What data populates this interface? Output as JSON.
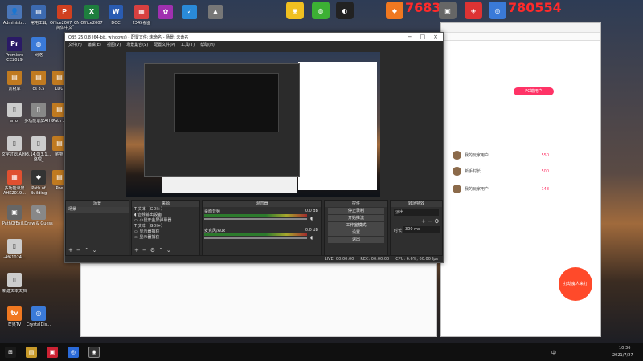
{
  "overlay": {
    "left_num": "76836",
    "right_num": "780554"
  },
  "top_icons": [
    {
      "name": "app-yellow-icon",
      "color": "#f0c020",
      "glyph": "◉"
    },
    {
      "name": "wechat-icon",
      "color": "#3cb034",
      "glyph": "◍"
    },
    {
      "name": "qq-icon",
      "color": "#222",
      "glyph": "◐"
    },
    {
      "name": "app-orange-icon",
      "color": "#f07820",
      "glyph": "◆"
    },
    {
      "name": "app-gray-icon",
      "color": "#666",
      "glyph": "▣"
    },
    {
      "name": "app-red-icon",
      "color": "#d33",
      "glyph": "◈"
    },
    {
      "name": "app-blue-icon",
      "color": "#3a7ad8",
      "glyph": "◎"
    }
  ],
  "desktop_icons": [
    {
      "label": "Administr...",
      "color": "#4a76b8",
      "glyph": "👤"
    },
    {
      "label": "常用工具",
      "color": "#3c6ab0",
      "glyph": "▤"
    },
    {
      "label": "Office2007_CN 简体中文",
      "color": "#d04020",
      "glyph": "P"
    },
    {
      "label": "Office2007",
      "color": "#1e7e3e",
      "glyph": "X"
    },
    {
      "label": "DOC",
      "color": "#2a5cb2",
      "glyph": "W"
    },
    {
      "label": "2345看图",
      "color": "#d84040",
      "glyph": "▦"
    },
    {
      "label": "",
      "color": "#a030b0",
      "glyph": "✿"
    },
    {
      "label": "",
      "color": "#2a8ad8",
      "glyph": "✓"
    },
    {
      "label": "",
      "color": "#777",
      "glyph": "▲"
    },
    {
      "label": "Premiere CC2019",
      "color": "#2a1a66",
      "glyph": "Pr"
    },
    {
      "label": "网络",
      "color": "#3a7ad8",
      "glyph": "◍"
    },
    {
      "label": "素材库",
      "color": "#c07a20",
      "glyph": "▤"
    },
    {
      "label": "cs 8.5",
      "color": "#c07a20",
      "glyph": "▤"
    },
    {
      "label": "LOG",
      "color": "#c07a20",
      "glyph": "▤"
    },
    {
      "label": "error",
      "color": "#ccc",
      "glyph": "▯"
    },
    {
      "label": "多功能录屏AHK",
      "color": "#888",
      "glyph": "▯"
    },
    {
      "label": "Path of",
      "color": "#c07a20",
      "glyph": "▤"
    },
    {
      "label": "文字过滤 AHK",
      "color": "#ccc",
      "glyph": "▯"
    },
    {
      "label": "3.14.0(3.1... 整理_",
      "color": "#ccc",
      "glyph": "▯"
    },
    {
      "label": "购物",
      "color": "#c07a20",
      "glyph": "▤"
    },
    {
      "label": "多功能录屏AHK2019...",
      "color": "#e05030",
      "glyph": "▦"
    },
    {
      "label": "Path of Building",
      "color": "#333",
      "glyph": "◆"
    },
    {
      "label": "Poe",
      "color": "#c07a20",
      "glyph": "▤"
    },
    {
      "label": "PathOfExil...",
      "color": "#666",
      "glyph": "▣"
    },
    {
      "label": "Draw & Guess",
      "color": "#888",
      "glyph": "✎"
    },
    {
      "label": "-4f61024...",
      "color": "#ccc",
      "glyph": "▯"
    },
    {
      "label": "新建文本文档",
      "color": "#ccc",
      "glyph": "▯"
    },
    {
      "label": "芒果TV",
      "color": "#f07820",
      "glyph": "tv"
    },
    {
      "label": "CrystalDis...",
      "color": "#3a7ad8",
      "glyph": "◎"
    }
  ],
  "obs": {
    "title": "OBS 25.0.8 (64-bit, windows) - 配置文件: 未命名 - 场景: 未命名",
    "menu": [
      "文件(F)",
      "编辑(E)",
      "视图(V)",
      "场景集合(S)",
      "配置文件(P)",
      "工具(T)",
      "帮助(H)"
    ],
    "docks": {
      "scenes": {
        "title": "场景",
        "items": [
          "场景"
        ]
      },
      "sources": {
        "title": "来源",
        "items": [
          "文本（GDI+）",
          "音频输出设备",
          "小鼠开金屏弹幕器",
          "文本（GDI+）",
          "显示器捕获",
          "显示器捕获"
        ]
      },
      "mixer": {
        "title": "混音器",
        "tracks": [
          {
            "name": "桌面音频",
            "db": "0.0 dB"
          },
          {
            "name": "麦克风/Aux",
            "db": "0.0 dB"
          }
        ]
      },
      "controls": {
        "title": "控件",
        "buttons": [
          "停止录制",
          "开始推流",
          "工作室模式",
          "设置",
          "退出"
        ]
      },
      "transitions": {
        "title": "转场特效",
        "type": "淡出",
        "duration_label": "时长",
        "duration": "300 ms"
      }
    },
    "status": {
      "live": "LIVE: 00:00:00",
      "rec": "REC: 00:00:00",
      "cpu": "CPU: 6.6%, 60.00 fps"
    }
  },
  "browser": {
    "tab_label": "我的直播间",
    "pc_button": "PC端用户",
    "users": [
      {
        "name": "我的玩家用户",
        "score": "550"
      },
      {
        "name": "新手村长",
        "score": "500"
      },
      {
        "name": "我的玩家用户",
        "score": "148"
      }
    ],
    "banner": "打劫魔人来打"
  },
  "taskbar": {
    "time": "10:36",
    "date": "2021/7/27",
    "lang": "中"
  }
}
